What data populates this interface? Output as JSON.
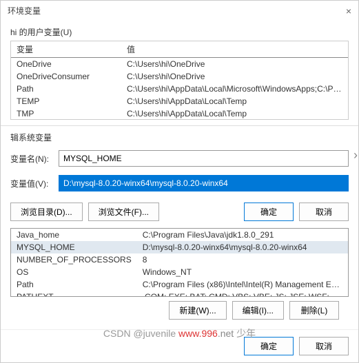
{
  "title": "环境变量",
  "user_vars": {
    "label": "hi 的用户变量(U)",
    "columns": [
      "变量",
      "值"
    ],
    "rows": [
      {
        "name": "OneDrive",
        "value": "C:\\Users\\hi\\OneDrive"
      },
      {
        "name": "OneDriveConsumer",
        "value": "C:\\Users\\hi\\OneDrive"
      },
      {
        "name": "Path",
        "value": "C:\\Users\\hi\\AppData\\Local\\Microsoft\\WindowsApps;C:\\Program Fi..."
      },
      {
        "name": "TEMP",
        "value": "C:\\Users\\hi\\AppData\\Local\\Temp"
      },
      {
        "name": "TMP",
        "value": "C:\\Users\\hi\\AppData\\Local\\Temp"
      }
    ]
  },
  "edit_dialog": {
    "title": "辑系统变量",
    "name_label": "变量名(N):",
    "value_label": "变量值(V):",
    "name": "MYSQL_HOME",
    "value": "D:\\mysql-8.0.20-winx64\\mysql-8.0.20-winx64",
    "browse_dir": "浏览目录(D)...",
    "browse_file": "浏览文件(F)...",
    "ok": "确定",
    "cancel": "取消"
  },
  "sys_vars": {
    "rows": [
      {
        "name": "Java_home",
        "value": "C:\\Program Files\\Java\\jdk1.8.0_291"
      },
      {
        "name": "MYSQL_HOME",
        "value": "D:\\mysql-8.0.20-winx64\\mysql-8.0.20-winx64",
        "selected": true
      },
      {
        "name": "NUMBER_OF_PROCESSORS",
        "value": "8"
      },
      {
        "name": "OS",
        "value": "Windows_NT"
      },
      {
        "name": "Path",
        "value": "C:\\Program Files (x86)\\Intel\\Intel(R) Management Engine Compon..."
      },
      {
        "name": "PATHEXT",
        "value": ".COM;.EXE;.BAT;.CMD;.VBS;.VBE;.JS;.JSE;.WSF;.WSH;.MSC"
      }
    ]
  },
  "buttons": {
    "new": "新建(W)...",
    "edit": "编辑(I)...",
    "delete": "删除(L)",
    "ok": "确定",
    "cancel": "取消"
  },
  "watermark": {
    "red": "www.996",
    "grey1": "CSDN @juvenile",
    "grey2": ".net",
    "grey3": "少年"
  }
}
